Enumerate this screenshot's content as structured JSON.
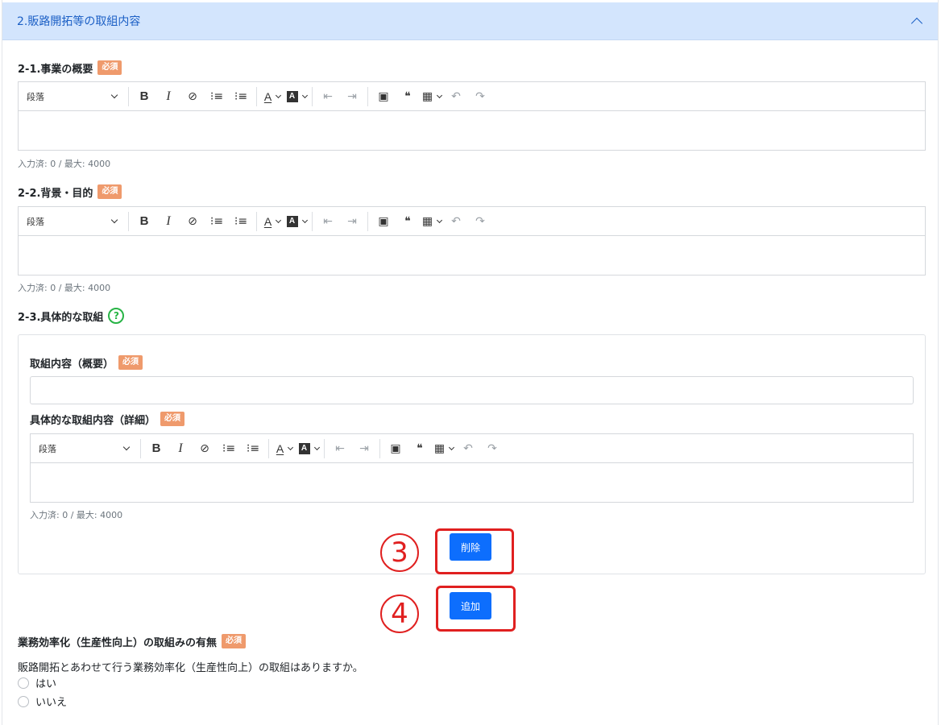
{
  "section": {
    "title": "2.販路開拓等の取組内容"
  },
  "required_badge": "必須",
  "fields": {
    "overview": {
      "label": "2-1.事業の概要",
      "counter": "入力済: 0 / 最大: 4000"
    },
    "background": {
      "label": "2-2.背景・目的",
      "counter": "入力済: 0 / 最大: 4000"
    },
    "concrete": {
      "label": "2-3.具体的な取組"
    }
  },
  "card": {
    "summary_label": "取組内容（概要）",
    "detail_label": "具体的な取組内容（詳細）",
    "detail_counter": "入力済: 0 / 最大: 4000",
    "delete_label": "削除"
  },
  "toolbar": {
    "paragraph": "段落",
    "bold": "B",
    "italic": "I",
    "link_glyph": "⊘",
    "bullet_glyph": "⁝≡",
    "number_glyph": "⁝≡",
    "font_color": "A",
    "bg_color": "A",
    "outdent_glyph": "⇤",
    "indent_glyph": "⇥",
    "image_glyph": "▣",
    "quote_glyph": "❝",
    "table_glyph": "▦",
    "undo_glyph": "↶",
    "redo_glyph": "↷"
  },
  "add_label": "追加",
  "annotations": {
    "three": "3",
    "four": "4"
  },
  "efficiency": {
    "label": "業務効率化（生産性向上）の取組みの有無",
    "question": "販路開拓とあわせて行う業務効率化（生産性向上）の取組はありますか。",
    "options": [
      "はい",
      "いいえ"
    ]
  },
  "colors": {
    "header_bg": "#d3e5fd",
    "primary": "#0d6efd",
    "badge": "#ef9a6c",
    "annotation": "#e02020",
    "help": "#28b446"
  },
  "icons": [
    "chevron-up-icon",
    "help-icon",
    "bold-icon",
    "italic-icon",
    "link-icon",
    "bulleted-list-icon",
    "numbered-list-icon",
    "font-color-icon",
    "background-color-icon",
    "outdent-icon",
    "indent-icon",
    "image-icon",
    "quote-icon",
    "table-icon",
    "undo-icon",
    "redo-icon"
  ]
}
